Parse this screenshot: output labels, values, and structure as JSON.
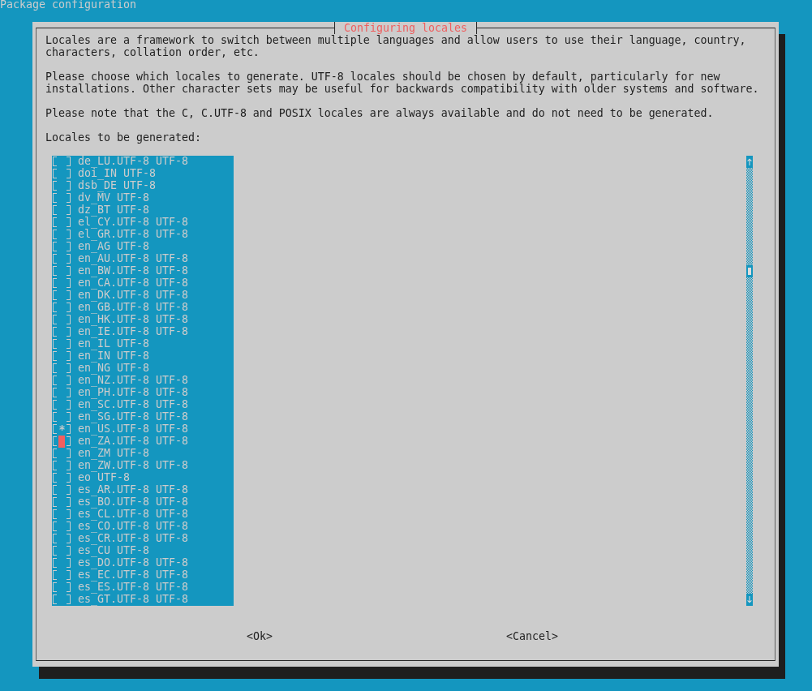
{
  "screen_title": "Package configuration",
  "dialog": {
    "title": "Configuring locales",
    "paragraphs": [
      "Locales are a framework to switch between multiple languages and allow users to use their language, country, characters, collation order, etc.",
      "Please choose which locales to generate. UTF-8 locales should be chosen by default, particularly for new installations. Other character sets may be useful for backwards compatibility with older systems and software.",
      "Please note that the C, C.UTF-8 and POSIX locales are always available and do not need to be generated."
    ],
    "list_label": "Locales to be generated:",
    "locales": [
      {
        "label": "de_LU.UTF-8 UTF-8",
        "checked": false,
        "focused": false
      },
      {
        "label": "doi_IN UTF-8",
        "checked": false,
        "focused": false
      },
      {
        "label": "dsb_DE UTF-8",
        "checked": false,
        "focused": false
      },
      {
        "label": "dv_MV UTF-8",
        "checked": false,
        "focused": false
      },
      {
        "label": "dz_BT UTF-8",
        "checked": false,
        "focused": false
      },
      {
        "label": "el_CY.UTF-8 UTF-8",
        "checked": false,
        "focused": false
      },
      {
        "label": "el_GR.UTF-8 UTF-8",
        "checked": false,
        "focused": false
      },
      {
        "label": "en_AG UTF-8",
        "checked": false,
        "focused": false
      },
      {
        "label": "en_AU.UTF-8 UTF-8",
        "checked": false,
        "focused": false
      },
      {
        "label": "en_BW.UTF-8 UTF-8",
        "checked": false,
        "focused": false
      },
      {
        "label": "en_CA.UTF-8 UTF-8",
        "checked": false,
        "focused": false
      },
      {
        "label": "en_DK.UTF-8 UTF-8",
        "checked": false,
        "focused": false
      },
      {
        "label": "en_GB.UTF-8 UTF-8",
        "checked": false,
        "focused": false
      },
      {
        "label": "en_HK.UTF-8 UTF-8",
        "checked": false,
        "focused": false
      },
      {
        "label": "en_IE.UTF-8 UTF-8",
        "checked": false,
        "focused": false
      },
      {
        "label": "en_IL UTF-8",
        "checked": false,
        "focused": false
      },
      {
        "label": "en_IN UTF-8",
        "checked": false,
        "focused": false
      },
      {
        "label": "en_NG UTF-8",
        "checked": false,
        "focused": false
      },
      {
        "label": "en_NZ.UTF-8 UTF-8",
        "checked": false,
        "focused": false
      },
      {
        "label": "en_PH.UTF-8 UTF-8",
        "checked": false,
        "focused": false
      },
      {
        "label": "en_SC.UTF-8 UTF-8",
        "checked": false,
        "focused": false
      },
      {
        "label": "en_SG.UTF-8 UTF-8",
        "checked": false,
        "focused": false
      },
      {
        "label": "en_US.UTF-8 UTF-8",
        "checked": true,
        "focused": false
      },
      {
        "label": "en_ZA.UTF-8 UTF-8",
        "checked": false,
        "focused": true
      },
      {
        "label": "en_ZM UTF-8",
        "checked": false,
        "focused": false
      },
      {
        "label": "en_ZW.UTF-8 UTF-8",
        "checked": false,
        "focused": false
      },
      {
        "label": "eo UTF-8",
        "checked": false,
        "focused": false
      },
      {
        "label": "es_AR.UTF-8 UTF-8",
        "checked": false,
        "focused": false
      },
      {
        "label": "es_BO.UTF-8 UTF-8",
        "checked": false,
        "focused": false
      },
      {
        "label": "es_CL.UTF-8 UTF-8",
        "checked": false,
        "focused": false
      },
      {
        "label": "es_CO.UTF-8 UTF-8",
        "checked": false,
        "focused": false
      },
      {
        "label": "es_CR.UTF-8 UTF-8",
        "checked": false,
        "focused": false
      },
      {
        "label": "es_CU UTF-8",
        "checked": false,
        "focused": false
      },
      {
        "label": "es_DO.UTF-8 UTF-8",
        "checked": false,
        "focused": false
      },
      {
        "label": "es_EC.UTF-8 UTF-8",
        "checked": false,
        "focused": false
      },
      {
        "label": "es_ES.UTF-8 UTF-8",
        "checked": false,
        "focused": false
      },
      {
        "label": "es_GT.UTF-8 UTF-8",
        "checked": false,
        "focused": false
      }
    ],
    "buttons": [
      {
        "label": "<Ok>"
      },
      {
        "label": "<Cancel>"
      }
    ]
  }
}
